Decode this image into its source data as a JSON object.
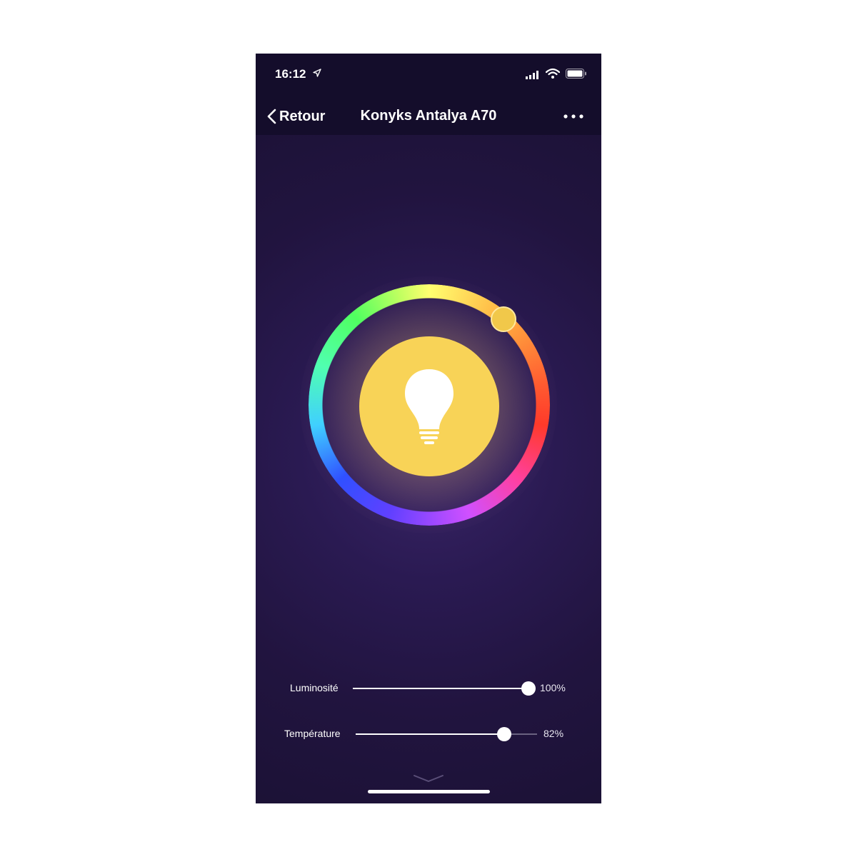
{
  "status_bar": {
    "time": "16:12"
  },
  "nav": {
    "back_label": "Retour",
    "title": "Konyks Antalya A70"
  },
  "color_wheel": {
    "selected_color": "#f1c84a",
    "bulb_color": "#f8d357"
  },
  "sliders": {
    "brightness": {
      "label": "Luminosité",
      "value_text": "100%",
      "value": 1.0
    },
    "temperature": {
      "label": "Température",
      "value_text": "82%",
      "value": 0.82
    }
  },
  "icons": {
    "location": "location-arrow-icon",
    "signal": "cellular-signal-icon",
    "wifi": "wifi-icon",
    "battery": "battery-icon",
    "more": "more-dots-icon",
    "bulb": "lightbulb-icon",
    "chevron": "chevron-down-icon"
  }
}
